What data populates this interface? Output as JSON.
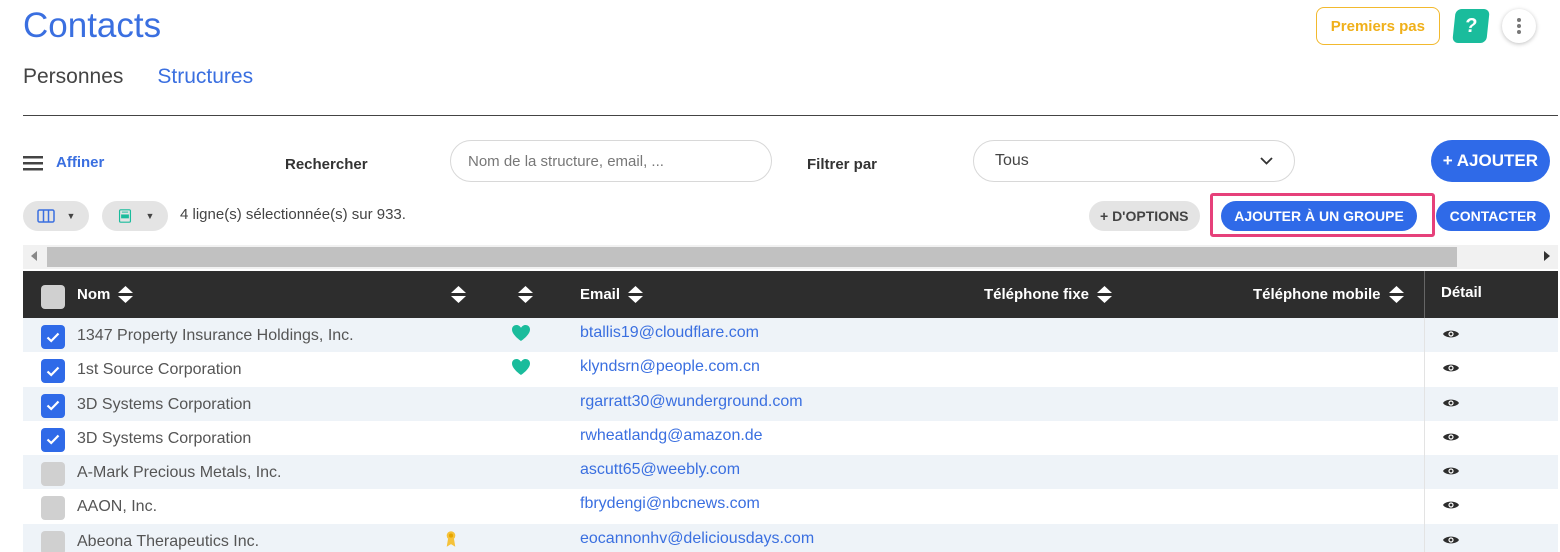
{
  "header": {
    "title": "Contacts",
    "tabs": [
      {
        "label": "Personnes",
        "active": false
      },
      {
        "label": "Structures",
        "active": true
      }
    ],
    "premiers_pas": "Premiers pas",
    "help": "?"
  },
  "filters": {
    "affiner": "Affiner",
    "rechercher_label": "Rechercher",
    "search_placeholder": "Nom de la structure, email, ...",
    "search_value": "",
    "filtrer_label": "Filtrer par",
    "filtrer_value": "Tous",
    "ajouter": "+ AJOUTER"
  },
  "toolbar": {
    "selection_text": "4 ligne(s) sélectionnée(s) sur 933.",
    "options": "+ D'OPTIONS",
    "add_group": "AJOUTER À UN GROUPE",
    "contact": "CONTACTER"
  },
  "table": {
    "columns": {
      "nom": "Nom",
      "email": "Email",
      "tel_fixe": "Téléphone fixe",
      "tel_mobile": "Téléphone mobile",
      "detail": "Détail"
    },
    "rows": [
      {
        "name": "1347 Property Insurance Holdings, Inc.",
        "email": "btallis19@cloudflare.com",
        "checked": true,
        "heart": true,
        "badge": false
      },
      {
        "name": "1st Source Corporation",
        "email": "klyndsrn@people.com.cn",
        "checked": true,
        "heart": true,
        "badge": false
      },
      {
        "name": "3D Systems Corporation",
        "email": "rgarratt30@wunderground.com",
        "checked": true,
        "heart": false,
        "badge": false
      },
      {
        "name": "3D Systems Corporation",
        "email": "rwheatlandg@amazon.de",
        "checked": true,
        "heart": false,
        "badge": false
      },
      {
        "name": "A-Mark Precious Metals, Inc.",
        "email": "ascutt65@weebly.com",
        "checked": false,
        "heart": false,
        "badge": false
      },
      {
        "name": "AAON, Inc.",
        "email": "fbrydengi@nbcnews.com",
        "checked": false,
        "heart": false,
        "badge": false
      },
      {
        "name": "Abeona Therapeutics Inc.",
        "email": "eocannonhv@deliciousdays.com",
        "checked": false,
        "heart": false,
        "badge": true
      }
    ]
  },
  "colors": {
    "accent": "#2f6ae8",
    "title": "#3a6fe0",
    "heart": "#1abc9c",
    "highlight": "#e6407a",
    "premiers": "#f0b01a"
  }
}
